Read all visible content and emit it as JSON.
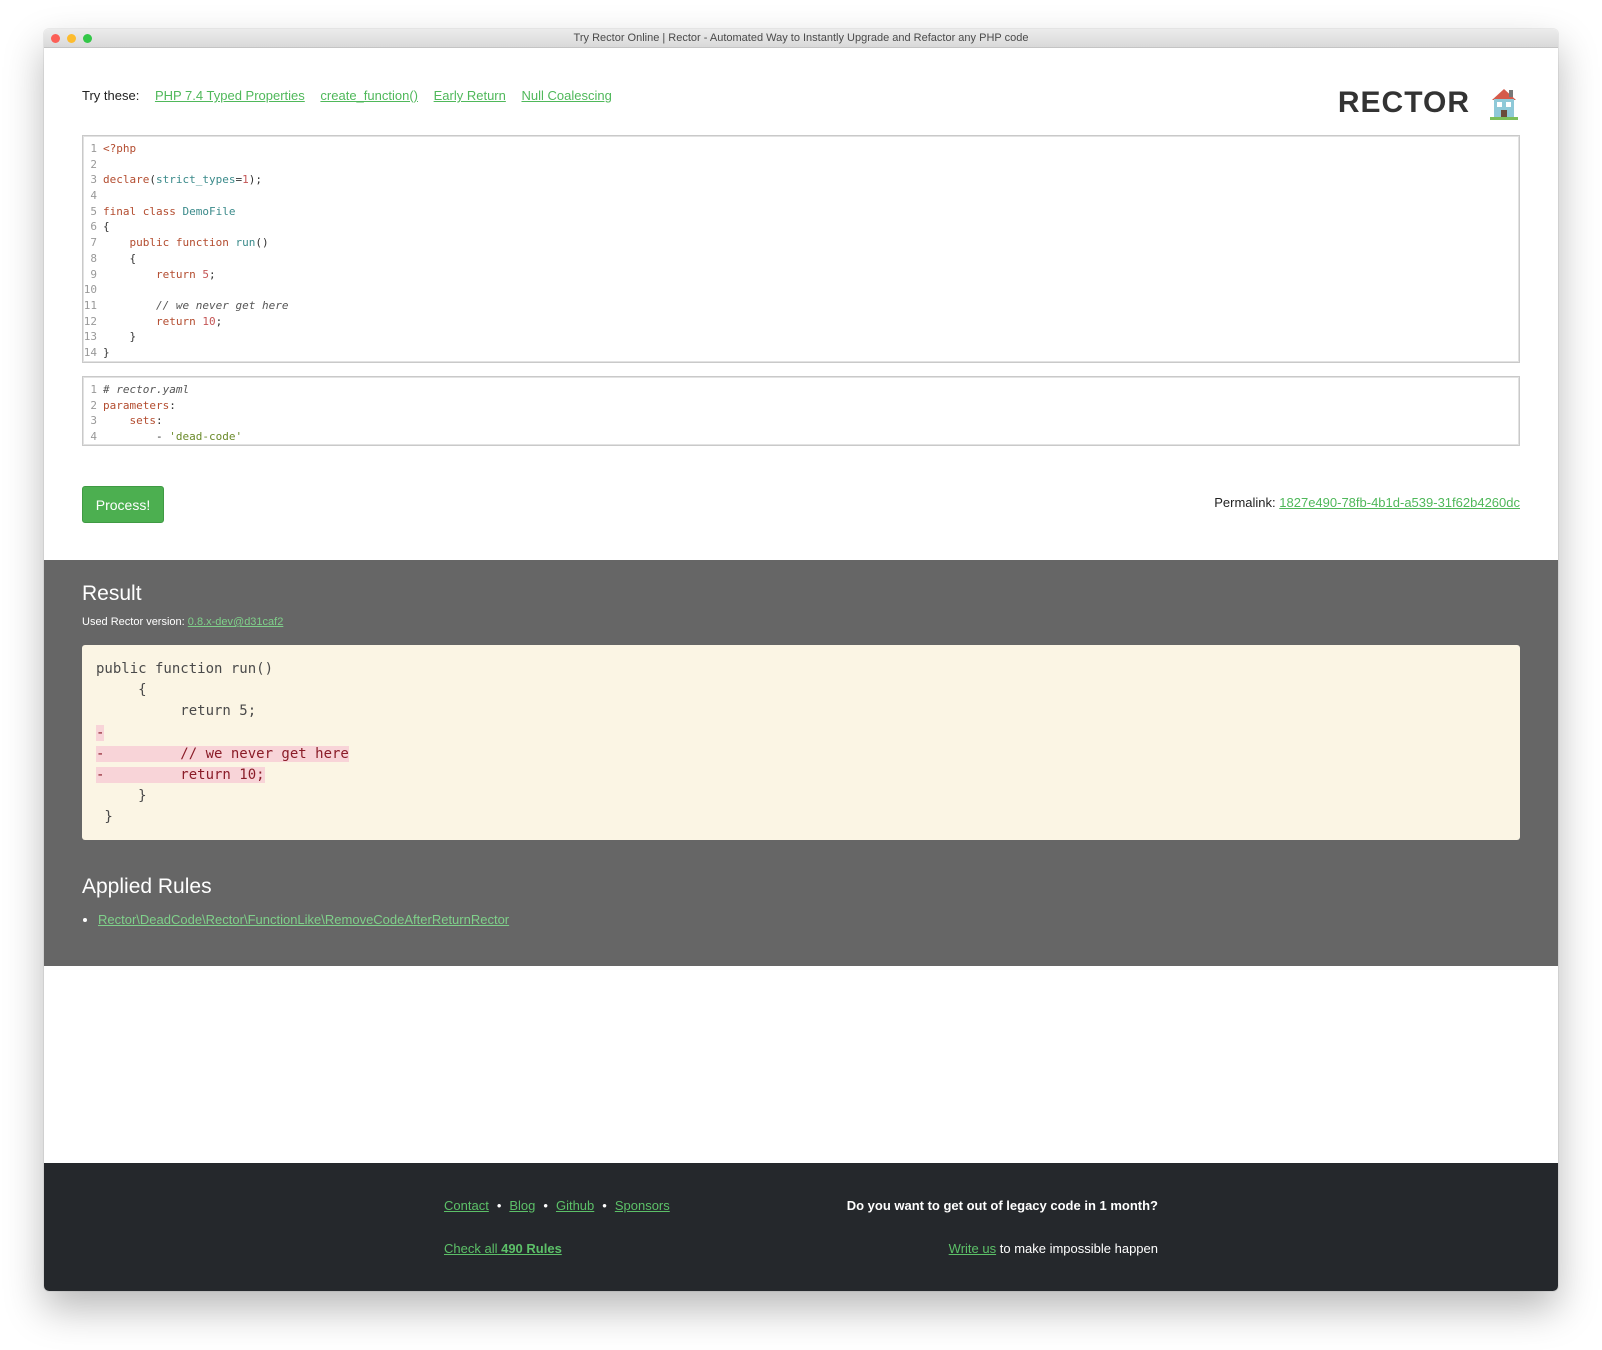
{
  "window": {
    "title": "Try Rector Online | Rector - Automated Way to Instantly Upgrade and Refactor any PHP code"
  },
  "try_these": {
    "label": "Try these:",
    "links": [
      "PHP 7.4 Typed Properties",
      "create_function()",
      "Early Return",
      "Null Coalescing"
    ]
  },
  "logo": {
    "text": "RECTOR",
    "icon": "house-icon"
  },
  "php_editor": {
    "line_numbers": [
      "1",
      "2",
      "3",
      "4",
      "5",
      "6",
      "7",
      "8",
      "9",
      "10",
      "11",
      "12",
      "13",
      "14"
    ]
  },
  "config_editor": {
    "line_numbers": [
      "1",
      "2",
      "3",
      "4"
    ]
  },
  "process_button": "Process!",
  "permalink": {
    "label": "Permalink:",
    "value": "1827e490-78fb-4b1d-a539-31f62b4260dc"
  },
  "result": {
    "title": "Result",
    "version_label": "Used Rector version:",
    "version_value": "0.8.x-dev@d31caf2",
    "diff": [
      {
        "text": "public function run()",
        "deleted": false
      },
      {
        "text": "     {",
        "deleted": false
      },
      {
        "text": "          return 5;",
        "deleted": false
      },
      {
        "text": "-",
        "deleted": true
      },
      {
        "text": "-         // we never get here",
        "deleted": true
      },
      {
        "text": "-         return 10;",
        "deleted": true
      },
      {
        "text": "     }",
        "deleted": false
      },
      {
        "text": " }",
        "deleted": false
      }
    ]
  },
  "applied_rules": {
    "title": "Applied Rules",
    "items": [
      "Rector\\DeadCode\\Rector\\FunctionLike\\RemoveCodeAfterReturnRector"
    ]
  },
  "footer": {
    "links": [
      "Contact",
      "Blog",
      "Github",
      "Sponsors"
    ],
    "separator": "•",
    "check_prefix": "Check all",
    "check_count": "490 Rules",
    "question": "Do you want to get out of legacy code in 1 month?",
    "write_link": "Write us",
    "write_suffix": "to make impossible happen"
  },
  "colors": {
    "accent": "#4caf50",
    "link": "#4fb85a",
    "result_bg": "#666666",
    "footer_bg": "#25282c",
    "diff_bg": "#fbf5e4",
    "diff_del": "#f8d4d8"
  }
}
